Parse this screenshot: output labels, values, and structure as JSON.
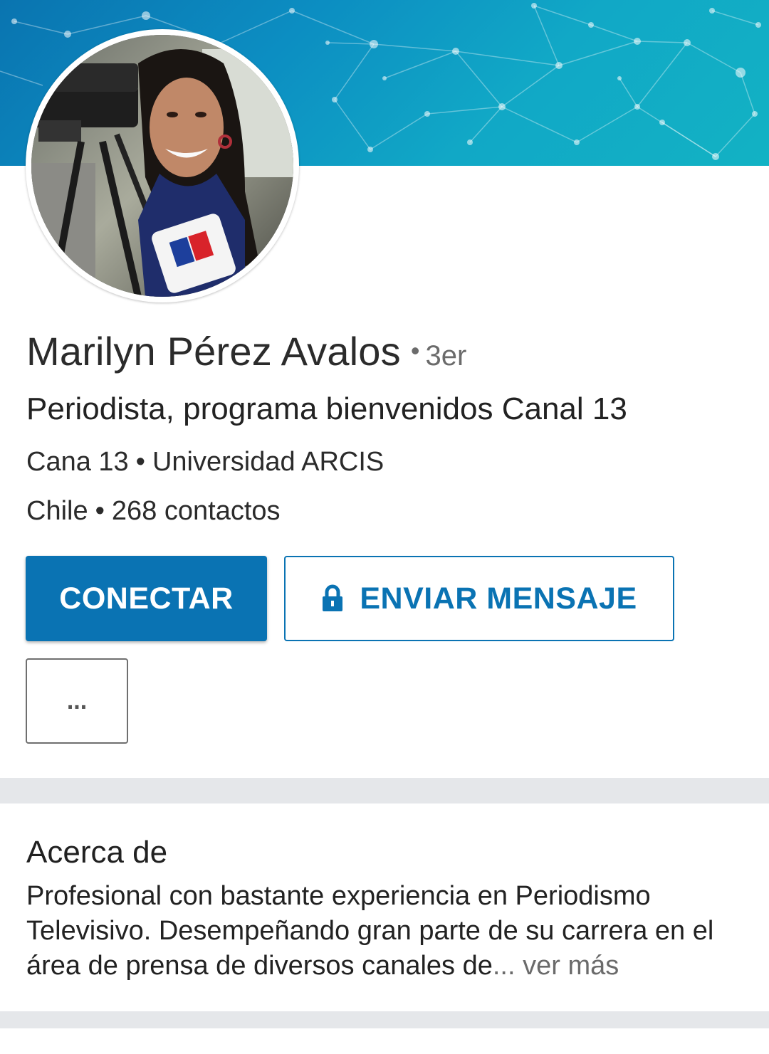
{
  "profile": {
    "name": "Marilyn Pérez Avalos",
    "degree_separator": "•",
    "degree": "3er",
    "headline": "Periodista, programa bienvenidos Canal 13",
    "company": "Cana 13",
    "school": "Universidad ARCIS",
    "location": "Chile",
    "connections": "268 contactos",
    "separator": "•"
  },
  "actions": {
    "connect_label": "CONECTAR",
    "message_label": "ENVIAR MENSAJE",
    "more_label": "..."
  },
  "about": {
    "title": "Acerca de",
    "text": "Profesional con bastante experiencia en Periodismo Televisivo. Desempeñando gran parte de su carrera en el área de prensa de diversos canales de",
    "ellipsis": "...",
    "see_more": "ver más"
  },
  "icons": {
    "lock": "lock-icon",
    "banner_pattern": "network-pattern"
  },
  "colors": {
    "accent": "#0a73b3",
    "banner": "#12b2c4",
    "divider": "#e5e7ea",
    "secondary_text": "#6b6b6b"
  }
}
